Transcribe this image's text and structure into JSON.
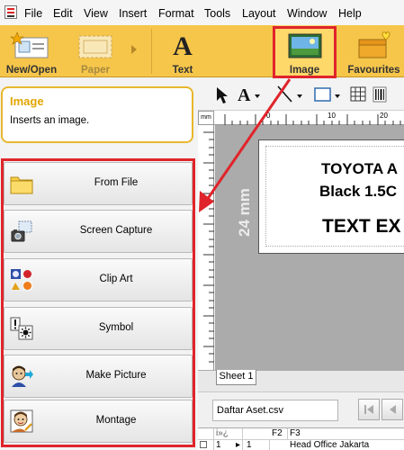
{
  "menubar": {
    "items": [
      "File",
      "Edit",
      "View",
      "Insert",
      "Format",
      "Tools",
      "Layout",
      "Window",
      "Help"
    ]
  },
  "ribbon": {
    "buttons": [
      {
        "label": "New/Open",
        "icon": "new-open-icon",
        "enabled": true
      },
      {
        "label": "Paper",
        "icon": "paper-icon",
        "enabled": false
      },
      {
        "label": "Text",
        "icon": "text-icon",
        "enabled": true
      },
      {
        "label": "Image",
        "icon": "image-icon",
        "enabled": true,
        "selected": true
      },
      {
        "label": "Favourites",
        "icon": "favourites-icon",
        "enabled": true
      }
    ]
  },
  "infobox": {
    "title": "Image",
    "description": "Inserts an image."
  },
  "commands": [
    {
      "label": "From File",
      "icon": "folder-icon"
    },
    {
      "label": "Screen Capture",
      "icon": "camera-icon"
    },
    {
      "label": "Clip Art",
      "icon": "clipart-icon"
    },
    {
      "label": "Symbol",
      "icon": "symbol-icon"
    },
    {
      "label": "Make Picture",
      "icon": "make-picture-icon"
    },
    {
      "label": "Montage",
      "icon": "montage-icon"
    }
  ],
  "ruler": {
    "unit": "mm",
    "ticks": [
      "0",
      "10",
      "20"
    ]
  },
  "label": {
    "height_text": "24 mm",
    "line1": "TOYOTA A",
    "line2": "Black 1.5C",
    "line3": "TEXT EX"
  },
  "sheet": {
    "tab": "Sheet 1"
  },
  "database": {
    "name": "Daftar Aset.csv",
    "columns": [
      "i»¿",
      "F2",
      "F3"
    ],
    "row": {
      "num": "1",
      "c1": "1",
      "c3": "Head Office Jakarta"
    }
  },
  "colors": {
    "ribbon": "#f6c64b",
    "highlight": "#e0242b",
    "accent_title": "#e2a500"
  }
}
